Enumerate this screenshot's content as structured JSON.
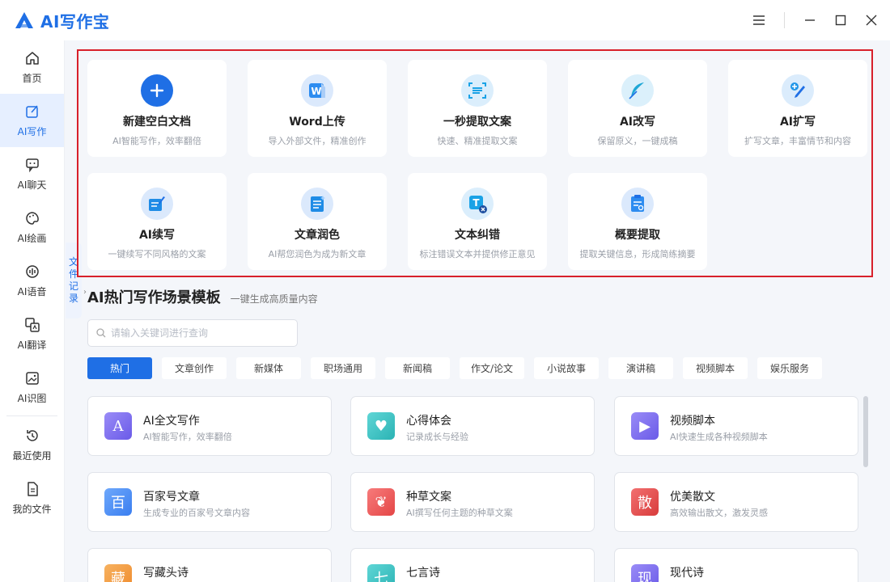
{
  "app": {
    "title": "AI写作宝",
    "brand_color": "#1f6fe5",
    "outline_color": "#d8202a"
  },
  "window_controls": {
    "menu_icon": "menu-icon",
    "minimize_icon": "minimize-icon",
    "maximize_icon": "maximize-icon",
    "close_icon": "close-icon"
  },
  "sidebar": {
    "items": [
      {
        "label": "首页",
        "icon": "home-icon"
      },
      {
        "label": "AI写作",
        "icon": "edit-icon",
        "active": true
      },
      {
        "label": "AI聊天",
        "icon": "chat-icon"
      },
      {
        "label": "AI绘画",
        "icon": "palette-icon"
      },
      {
        "label": "AI语音",
        "icon": "voice-icon"
      },
      {
        "label": "AI翻译",
        "icon": "translate-icon"
      },
      {
        "label": "AI识图",
        "icon": "image-recognize-icon"
      },
      {
        "label": "最近使用",
        "icon": "history-icon"
      },
      {
        "label": "我的文件",
        "icon": "file-icon"
      }
    ]
  },
  "file_records_tab": {
    "chars": [
      "文",
      "件",
      "记",
      "录"
    ]
  },
  "tools": [
    {
      "title": "新建空白文档",
      "desc": "AI智能写作，效率翻倍",
      "icon": "plus-icon",
      "color": "#1f6fe5"
    },
    {
      "title": "Word上传",
      "desc": "导入外部文件，精准创作",
      "icon": "word-upload-icon",
      "color": "#2d8cf0"
    },
    {
      "title": "一秒提取文案",
      "desc": "快速、精准提取文案",
      "icon": "scan-text-icon",
      "color": "#1aa2e6"
    },
    {
      "title": "AI改写",
      "desc": "保留原义，一键成稿",
      "icon": "feather-icon",
      "color": "#1fa7d6"
    },
    {
      "title": "AI扩写",
      "desc": "扩写文章，丰富情节和内容",
      "icon": "expand-write-icon",
      "color": "#2196e8"
    },
    {
      "title": "AI续写",
      "desc": "一键续写不同风格的文案",
      "icon": "continue-write-icon",
      "color": "#1f8ce6"
    },
    {
      "title": "文章润色",
      "desc": "AI帮您润色为成为新文章",
      "icon": "polish-icon",
      "color": "#1f8ce6"
    },
    {
      "title": "文本纠错",
      "desc": "标注错误文本并提供修正意见",
      "icon": "text-correct-icon",
      "color": "#1aa2e6"
    },
    {
      "title": "概要提取",
      "desc": "提取关键信息，形成简练摘要",
      "icon": "summary-icon",
      "color": "#2d8cf0"
    }
  ],
  "templates_section": {
    "title": "AI热门写作场景模板",
    "subtitle": "一键生成高质量内容",
    "search_placeholder": "请输入关键词进行查询",
    "categories": [
      "热门",
      "文章创作",
      "新媒体",
      "职场通用",
      "新闻稿",
      "作文/论文",
      "小说故事",
      "演讲稿",
      "视频脚本",
      "娱乐服务"
    ],
    "active_category": "热门",
    "cards": [
      {
        "title": "AI全文写作",
        "desc": "AI智能写作，效率翻倍",
        "icon": "ai-write-icon",
        "color": "#7b6cf0",
        "glyph": "A"
      },
      {
        "title": "心得体会",
        "desc": "记录成长与经验",
        "icon": "notebook-icon",
        "color": "#39c3c4",
        "glyph": "♥"
      },
      {
        "title": "视频脚本",
        "desc": "AI快速生成各种视频脚本",
        "icon": "video-script-icon",
        "color": "#7b6cf0",
        "glyph": "▶"
      },
      {
        "title": "百家号文章",
        "desc": "生成专业的百家号文章内容",
        "icon": "baijiahao-icon",
        "color": "#4a8df5",
        "glyph": "百"
      },
      {
        "title": "种草文案",
        "desc": "AI撰写任何主题的种草文案",
        "icon": "sprout-icon",
        "color": "#ee5b5b",
        "glyph": "❦"
      },
      {
        "title": "优美散文",
        "desc": "高效输出散文，激发灵感",
        "icon": "prose-icon",
        "color": "#e84f4f",
        "glyph": "散"
      },
      {
        "title": "写藏头诗",
        "desc": "",
        "icon": "acrostic-poem-icon",
        "color": "#f39a3e",
        "glyph": "藏"
      },
      {
        "title": "七言诗",
        "desc": "",
        "icon": "seven-char-poem-icon",
        "color": "#39c3c4",
        "glyph": "七"
      },
      {
        "title": "现代诗",
        "desc": "",
        "icon": "modern-poem-icon",
        "color": "#7b6cf0",
        "glyph": "现"
      }
    ]
  }
}
